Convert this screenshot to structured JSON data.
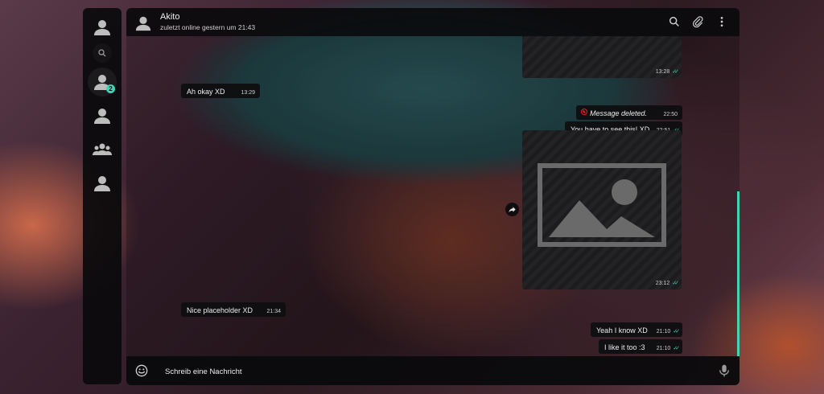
{
  "header": {
    "contact_name": "Akito",
    "status": "zuletzt online gestern um 21:43"
  },
  "sidebar": {
    "items": [
      {
        "icon": "person-icon"
      },
      {
        "icon": "search-icon"
      },
      {
        "icon": "person-icon",
        "badge": "2"
      },
      {
        "icon": "person-icon"
      },
      {
        "icon": "group-icon"
      },
      {
        "icon": "person-icon"
      }
    ]
  },
  "messages": [
    {
      "side": "out",
      "type": "image",
      "time": "13:28"
    },
    {
      "side": "in",
      "text": "Ah okay XD",
      "time": "13:29"
    },
    {
      "side": "out",
      "type": "deleted",
      "text": "Message deleted.",
      "time": "22:50"
    },
    {
      "side": "out",
      "text": "You have to see this! XD",
      "time": "22:51"
    },
    {
      "side": "out",
      "type": "image",
      "time": "23:12"
    },
    {
      "side": "in",
      "text": "Nice placeholder XD",
      "time": "21:34"
    },
    {
      "side": "out",
      "text": "Yeah I know XD",
      "time": "21:10"
    },
    {
      "side": "out",
      "text": "I like it too :3",
      "time": "21:10"
    }
  ],
  "composer": {
    "placeholder": "Schreib eine Nachricht"
  },
  "colors": {
    "accent": "#3fd6b6",
    "deleted_icon": "#e02020",
    "panel": "#0a0a0c"
  }
}
